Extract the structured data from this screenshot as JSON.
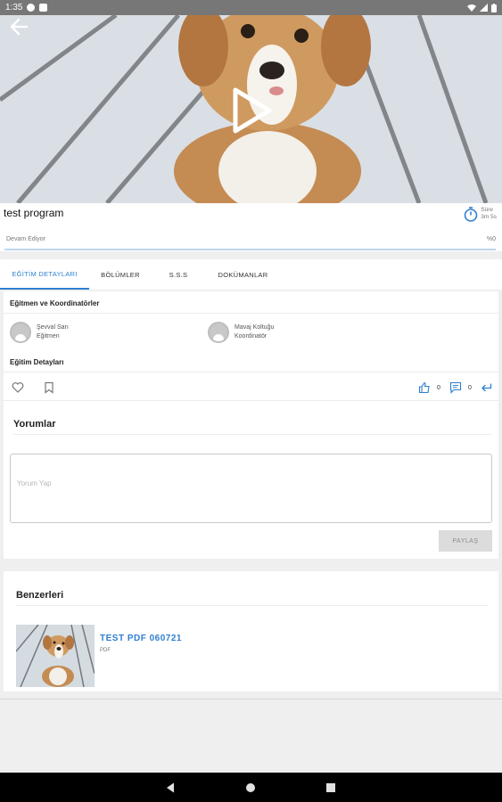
{
  "status_bar": {
    "time": "1:35"
  },
  "video": {
    "back_icon": "arrow-left-icon",
    "play_icon": "play-icon"
  },
  "program": {
    "title": "test program",
    "duration_label": "Süre",
    "duration_value": "3m 5s",
    "status": "Devam Ediyor",
    "progress_text": "%0",
    "progress_fraction": 0.0
  },
  "tabs": [
    {
      "label": "EĞİTİM DETAYLARI",
      "active": true
    },
    {
      "label": "BÖLÜMLER",
      "active": false
    },
    {
      "label": "S.S.S",
      "active": false
    },
    {
      "label": "DOKÜMANLAR",
      "active": false
    }
  ],
  "details": {
    "instructors_title": "Eğitmen ve Koordinatörler",
    "people": [
      {
        "name": "Şevval Sarı",
        "role": "Eğitmen"
      },
      {
        "name": "Mavaj Koltuğu",
        "role": "Koordinatör"
      }
    ],
    "details_title": "Eğitim Detayları",
    "like_count": "0",
    "comment_count": "0"
  },
  "comments": {
    "title": "Yorumlar",
    "placeholder": "Yorum Yap",
    "share_label": "PAYLAŞ"
  },
  "similar": {
    "title": "Benzerleri",
    "items": [
      {
        "title": "TEST PDF 060721",
        "type": "PDF"
      }
    ]
  },
  "colors": {
    "accent": "#2f7fd1",
    "status_bar": "#777777",
    "background": "#efeff0"
  }
}
